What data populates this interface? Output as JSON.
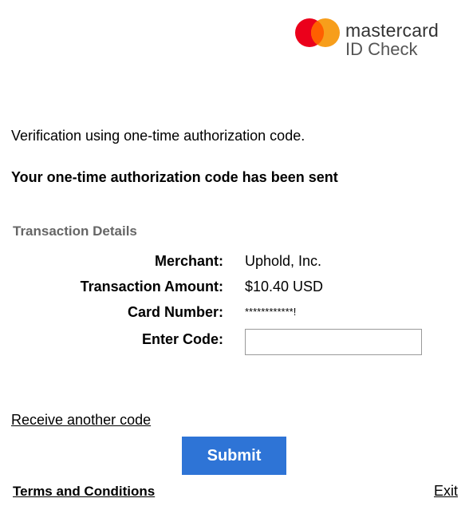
{
  "brand": {
    "name": "mastercard",
    "product": "ID Check",
    "colors": {
      "red": "#eb001b",
      "orange": "#f79e1b",
      "overlap": "#ff5f00"
    }
  },
  "intro_text": "Verification using one-time authorization code.",
  "sent_text": "Your one-time authorization code has been sent",
  "transaction": {
    "title": "Transaction Details",
    "merchant_label": "Merchant:",
    "merchant_value": "Uphold, Inc.",
    "amount_label": "Transaction Amount:",
    "amount_value": "$10.40 USD",
    "card_label": "Card Number:",
    "card_value": "************!",
    "code_label": "Enter Code:",
    "code_value": ""
  },
  "links": {
    "resend": "Receive another code",
    "terms": "Terms and Conditions",
    "exit": "Exit"
  },
  "buttons": {
    "submit": "Submit"
  },
  "accent_color": "#2e74d6"
}
